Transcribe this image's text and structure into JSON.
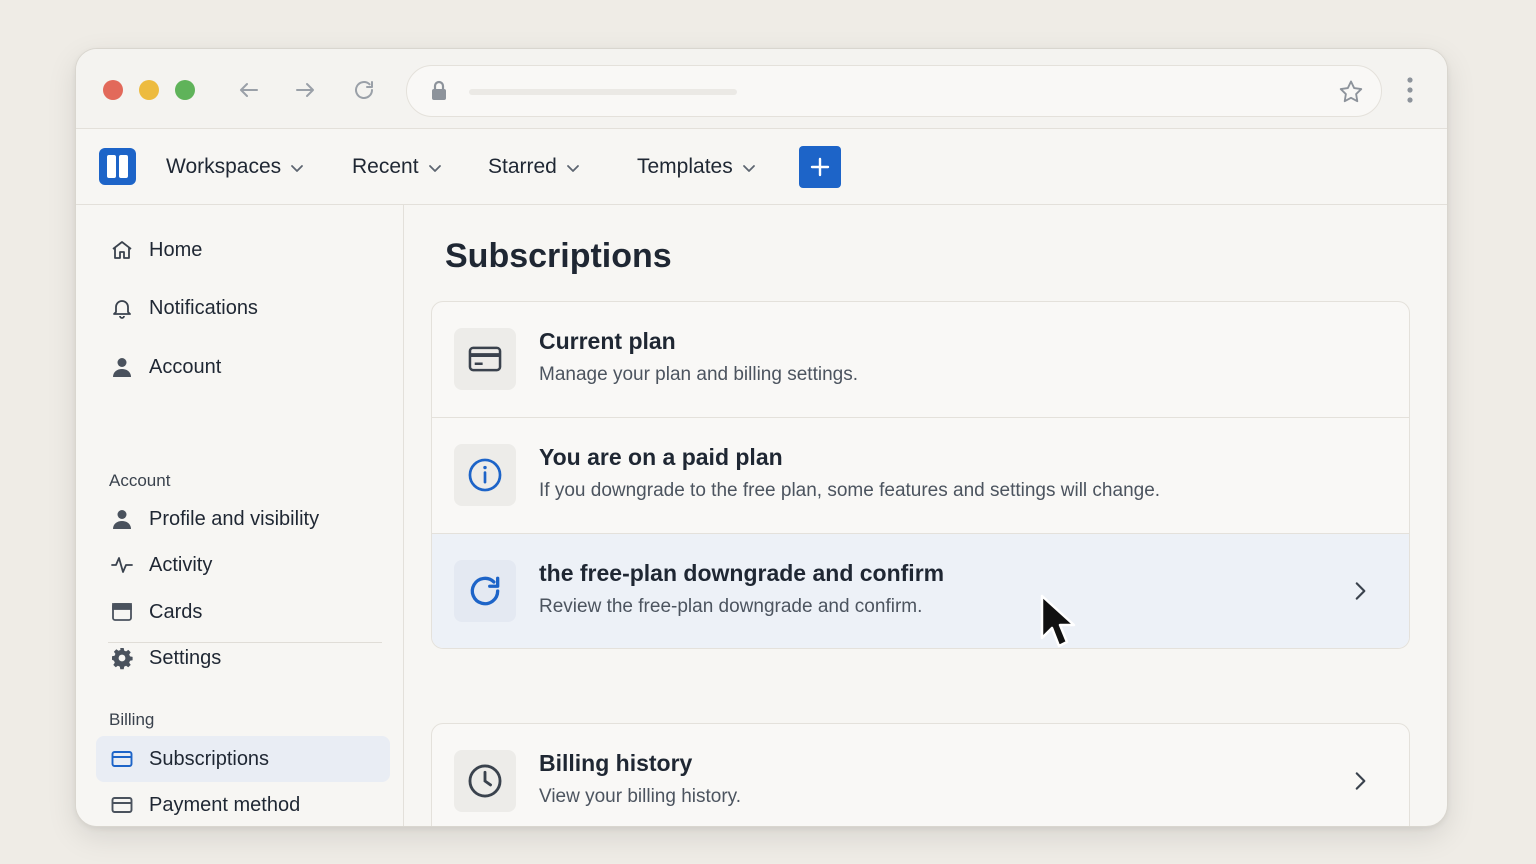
{
  "app_nav": {
    "items": [
      {
        "label": "Workspaces"
      },
      {
        "label": "Recent"
      },
      {
        "label": "Starred"
      },
      {
        "label": "Templates"
      }
    ]
  },
  "sidebar": {
    "top_items": [
      {
        "label": "Home",
        "icon": "home-icon"
      },
      {
        "label": "Notifications",
        "icon": "bell-icon"
      },
      {
        "label": "Account",
        "icon": "person-icon"
      }
    ],
    "account_heading": "Account",
    "account_items": [
      {
        "label": "Profile and visibility",
        "icon": "person-icon"
      },
      {
        "label": "Activity",
        "icon": "activity-icon"
      },
      {
        "label": "Cards",
        "icon": "card-icon"
      },
      {
        "label": "Settings",
        "icon": "gear-icon"
      }
    ],
    "billing_heading": "Billing",
    "billing_items": [
      {
        "label": "Subscriptions",
        "icon": "credit-card-icon",
        "active": true
      },
      {
        "label": "Payment method",
        "icon": "credit-card-icon"
      }
    ]
  },
  "main": {
    "title": "Subscriptions",
    "plan_rows": [
      {
        "title": "Current plan",
        "description": "Manage your plan and billing settings.",
        "icon": "credit-card-icon"
      },
      {
        "title": "You are on a paid plan",
        "description": "If you downgrade to the free plan, some features and settings will change.",
        "icon": "info-icon"
      },
      {
        "title": "the free-plan downgrade and confirm",
        "description": "Review the free-plan downgrade and confirm.",
        "icon": "refresh-icon",
        "highlighted": true
      }
    ],
    "history_row": {
      "title": "Billing history",
      "description": "View your billing history.",
      "icon": "clock-icon"
    }
  },
  "colors": {
    "accent": "#1d64c8",
    "highlight_row": "#edf1f7",
    "background": "#efece6"
  }
}
